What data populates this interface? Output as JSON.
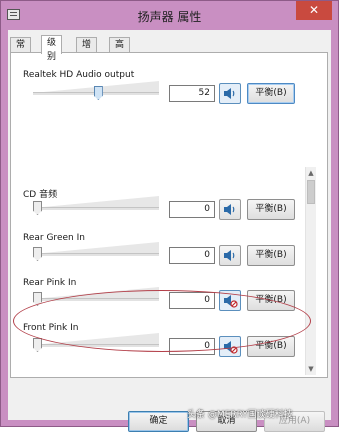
{
  "window": {
    "title": "扬声器 属性",
    "close_glyph": "✕",
    "accent_color": "#c98fc2"
  },
  "tabs": [
    {
      "label": "常规"
    },
    {
      "label": "级别",
      "active": true
    },
    {
      "label": "增强"
    },
    {
      "label": "高级"
    }
  ],
  "master": {
    "label": "Realtek HD Audio output",
    "value": "52",
    "level": 0.52,
    "muted": false,
    "balance_label": "平衡(B)",
    "speaker_icon": "speaker-icon"
  },
  "channels": [
    {
      "label": "CD 音频",
      "value": "0",
      "level": 0,
      "muted": false,
      "balance_label": "平衡(B)"
    },
    {
      "label": "Rear Green In",
      "value": "0",
      "level": 0,
      "muted": false,
      "balance_label": "平衡(B)"
    },
    {
      "label": "Rear Pink In",
      "value": "0",
      "level": 0,
      "muted": true,
      "balance_label": "平衡(B)"
    },
    {
      "label": "Front Pink In",
      "value": "0",
      "level": 0,
      "muted": true,
      "balance_label": "平衡(B)"
    }
  ],
  "buttons": {
    "ok": "确定",
    "cancel": "取消",
    "apply": "应用(A)"
  },
  "watermark": "头条 @MERRY国谈硬科技"
}
